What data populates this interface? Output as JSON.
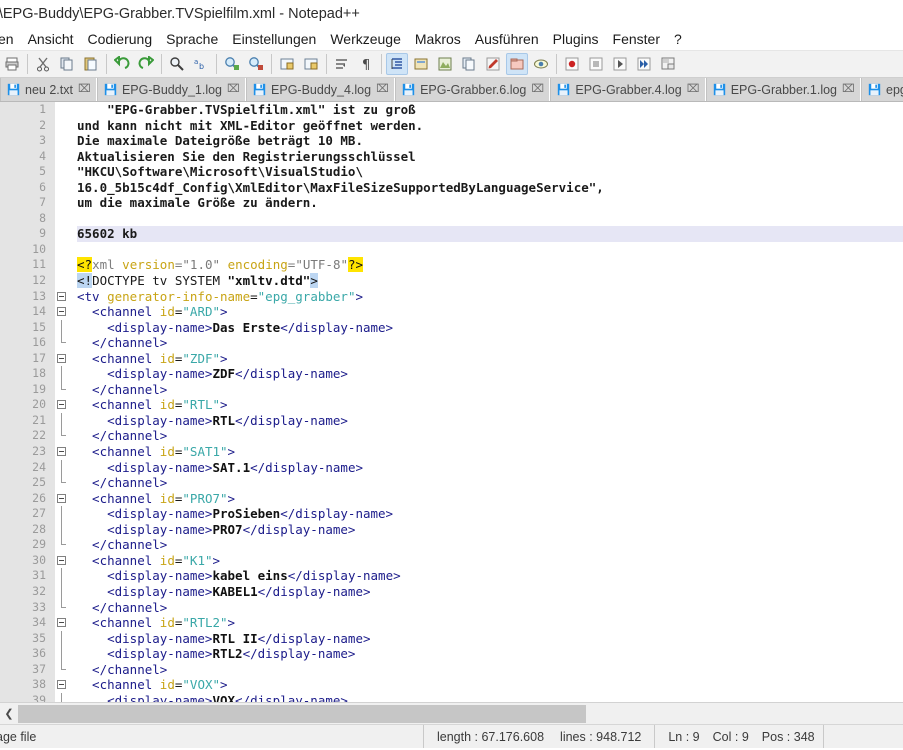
{
  "window": {
    "title": ")\\EPG-Buddy\\EPG-Grabber.TVSpielfilm.xml - Notepad++"
  },
  "menu": {
    "items": [
      {
        "label": "en"
      },
      {
        "label": "Ansicht"
      },
      {
        "label": "Codierung"
      },
      {
        "label": "Sprache"
      },
      {
        "label": "Einstellungen"
      },
      {
        "label": "Werkzeuge"
      },
      {
        "label": "Makros"
      },
      {
        "label": "Ausführen"
      },
      {
        "label": "Plugins"
      },
      {
        "label": "Fenster"
      },
      {
        "label": "?"
      }
    ]
  },
  "toolbar": {
    "buttons": [
      {
        "name": "print-icon",
        "active": false
      },
      {
        "name": "cut-icon",
        "active": false
      },
      {
        "name": "copy-icon",
        "active": false
      },
      {
        "name": "paste-icon",
        "active": false
      },
      {
        "name": "undo-icon",
        "active": false
      },
      {
        "name": "redo-icon",
        "active": false
      },
      {
        "name": "find-icon",
        "active": false
      },
      {
        "name": "replace-icon",
        "active": false
      },
      {
        "name": "zoom-in-icon",
        "active": false
      },
      {
        "name": "zoom-out-icon",
        "active": false
      },
      {
        "name": "sync-vertical-scroll-icon",
        "active": false
      },
      {
        "name": "sync-horizontal-scroll-icon",
        "active": false
      },
      {
        "name": "word-wrap-icon",
        "active": false
      },
      {
        "name": "show-all-characters-icon",
        "active": false
      },
      {
        "name": "indent-guide-icon",
        "active": true
      },
      {
        "name": "user-defined-language-icon",
        "active": false
      },
      {
        "name": "document-map-icon",
        "active": false
      },
      {
        "name": "function-list-icon",
        "active": false
      },
      {
        "name": "folder-as-workspace-icon",
        "active": false
      },
      {
        "name": "monitoring-icon",
        "active": true
      },
      {
        "name": "preview-icon",
        "active": false
      },
      {
        "name": "record-macro-icon",
        "active": false
      },
      {
        "name": "stop-macro-icon",
        "active": false
      },
      {
        "name": "play-macro-icon",
        "active": false
      },
      {
        "name": "run-macro-multiple-icon",
        "active": false
      },
      {
        "name": "save-macro-icon",
        "active": false
      }
    ]
  },
  "tabs": [
    {
      "label": "neu 2.txt",
      "active": false
    },
    {
      "label": "EPG-Buddy_1.log",
      "active": false
    },
    {
      "label": "EPG-Buddy_4.log",
      "active": false
    },
    {
      "label": "EPG-Grabber.6.log",
      "active": false
    },
    {
      "label": "EPG-Grabber.4.log",
      "active": false
    },
    {
      "label": "EPG-Grabber.1.log",
      "active": false
    },
    {
      "label": "epg grabber a",
      "active": false
    }
  ],
  "editor": {
    "first_line": 1,
    "current_line": 9,
    "change_marker_lines": [
      1,
      10
    ],
    "lines": [
      {
        "n": 1,
        "tokens": [
          {
            "c": "t-plain",
            "t": "    \"EPG-Grabber.TVSpielfilm.xml\" ist zu groß"
          }
        ]
      },
      {
        "n": 2,
        "tokens": [
          {
            "c": "t-plain",
            "t": "und kann nicht mit XML-Editor geöffnet werden."
          }
        ]
      },
      {
        "n": 3,
        "tokens": [
          {
            "c": "t-plain",
            "t": "Die maximale Dateigröße beträgt 10 MB."
          }
        ]
      },
      {
        "n": 4,
        "tokens": [
          {
            "c": "t-plain",
            "t": "Aktualisieren Sie den Registrierungsschlüssel"
          }
        ]
      },
      {
        "n": 5,
        "tokens": [
          {
            "c": "t-plain",
            "t": "\"HKCU\\Software\\Microsoft\\VisualStudio\\"
          }
        ]
      },
      {
        "n": 6,
        "tokens": [
          {
            "c": "t-plain",
            "t": "16.0_5b15c4df_Config\\XmlEditor\\MaxFileSizeSupportedByLanguageService\","
          }
        ]
      },
      {
        "n": 7,
        "tokens": [
          {
            "c": "t-plain",
            "t": "um die maximale Größe zu ändern."
          }
        ]
      },
      {
        "n": 8,
        "tokens": []
      },
      {
        "n": 9,
        "tokens": [
          {
            "c": "t-plain",
            "t": "65602 kb"
          }
        ]
      },
      {
        "n": 10,
        "tokens": []
      },
      {
        "n": 11,
        "tokens": [
          {
            "c": "t-pimark",
            "t": "<?"
          },
          {
            "c": "t-pi",
            "t": "xml "
          },
          {
            "c": "t-attr",
            "t": "version"
          },
          {
            "c": "t-pi",
            "t": "="
          },
          {
            "c": "t-str",
            "t": "\"1.0\""
          },
          {
            "c": "t-pi",
            "t": " "
          },
          {
            "c": "t-attr",
            "t": "encoding"
          },
          {
            "c": "t-pi",
            "t": "="
          },
          {
            "c": "t-str",
            "t": "\"UTF-8\""
          },
          {
            "c": "t-pimark",
            "t": "?>"
          }
        ]
      },
      {
        "n": 12,
        "tokens": [
          {
            "c": "t-dtmark",
            "t": "<!"
          },
          {
            "c": "t-doctype",
            "t": "DOCTYPE tv SYSTEM "
          },
          {
            "c": "t-content",
            "t": "\"xmltv.dtd\""
          },
          {
            "c": "t-dtmark",
            "t": ">"
          }
        ]
      },
      {
        "n": 13,
        "tokens": [
          {
            "c": "t-tag",
            "t": "<tv "
          },
          {
            "c": "t-attr",
            "t": "generator-info-name"
          },
          {
            "c": "t-eq",
            "t": "="
          },
          {
            "c": "t-val",
            "t": "\"epg_grabber\""
          },
          {
            "c": "t-tag",
            "t": ">"
          }
        ]
      },
      {
        "n": 14,
        "tokens": [
          {
            "c": "t-tag",
            "t": "  <channel "
          },
          {
            "c": "t-attr",
            "t": "id"
          },
          {
            "c": "t-eq",
            "t": "="
          },
          {
            "c": "t-val",
            "t": "\"ARD\""
          },
          {
            "c": "t-tag",
            "t": ">"
          }
        ]
      },
      {
        "n": 15,
        "tokens": [
          {
            "c": "t-tag",
            "t": "    <display-name>"
          },
          {
            "c": "t-content",
            "t": "Das Erste"
          },
          {
            "c": "t-tag",
            "t": "</display-name>"
          }
        ]
      },
      {
        "n": 16,
        "tokens": [
          {
            "c": "t-tag",
            "t": "  </channel>"
          }
        ]
      },
      {
        "n": 17,
        "tokens": [
          {
            "c": "t-tag",
            "t": "  <channel "
          },
          {
            "c": "t-attr",
            "t": "id"
          },
          {
            "c": "t-eq",
            "t": "="
          },
          {
            "c": "t-val",
            "t": "\"ZDF\""
          },
          {
            "c": "t-tag",
            "t": ">"
          }
        ]
      },
      {
        "n": 18,
        "tokens": [
          {
            "c": "t-tag",
            "t": "    <display-name>"
          },
          {
            "c": "t-content",
            "t": "ZDF"
          },
          {
            "c": "t-tag",
            "t": "</display-name>"
          }
        ]
      },
      {
        "n": 19,
        "tokens": [
          {
            "c": "t-tag",
            "t": "  </channel>"
          }
        ]
      },
      {
        "n": 20,
        "tokens": [
          {
            "c": "t-tag",
            "t": "  <channel "
          },
          {
            "c": "t-attr",
            "t": "id"
          },
          {
            "c": "t-eq",
            "t": "="
          },
          {
            "c": "t-val",
            "t": "\"RTL\""
          },
          {
            "c": "t-tag",
            "t": ">"
          }
        ]
      },
      {
        "n": 21,
        "tokens": [
          {
            "c": "t-tag",
            "t": "    <display-name>"
          },
          {
            "c": "t-content",
            "t": "RTL"
          },
          {
            "c": "t-tag",
            "t": "</display-name>"
          }
        ]
      },
      {
        "n": 22,
        "tokens": [
          {
            "c": "t-tag",
            "t": "  </channel>"
          }
        ]
      },
      {
        "n": 23,
        "tokens": [
          {
            "c": "t-tag",
            "t": "  <channel "
          },
          {
            "c": "t-attr",
            "t": "id"
          },
          {
            "c": "t-eq",
            "t": "="
          },
          {
            "c": "t-val",
            "t": "\"SAT1\""
          },
          {
            "c": "t-tag",
            "t": ">"
          }
        ]
      },
      {
        "n": 24,
        "tokens": [
          {
            "c": "t-tag",
            "t": "    <display-name>"
          },
          {
            "c": "t-content",
            "t": "SAT.1"
          },
          {
            "c": "t-tag",
            "t": "</display-name>"
          }
        ]
      },
      {
        "n": 25,
        "tokens": [
          {
            "c": "t-tag",
            "t": "  </channel>"
          }
        ]
      },
      {
        "n": 26,
        "tokens": [
          {
            "c": "t-tag",
            "t": "  <channel "
          },
          {
            "c": "t-attr",
            "t": "id"
          },
          {
            "c": "t-eq",
            "t": "="
          },
          {
            "c": "t-val",
            "t": "\"PRO7\""
          },
          {
            "c": "t-tag",
            "t": ">"
          }
        ]
      },
      {
        "n": 27,
        "tokens": [
          {
            "c": "t-tag",
            "t": "    <display-name>"
          },
          {
            "c": "t-content",
            "t": "ProSieben"
          },
          {
            "c": "t-tag",
            "t": "</display-name>"
          }
        ]
      },
      {
        "n": 28,
        "tokens": [
          {
            "c": "t-tag",
            "t": "    <display-name>"
          },
          {
            "c": "t-content",
            "t": "PRO7"
          },
          {
            "c": "t-tag",
            "t": "</display-name>"
          }
        ]
      },
      {
        "n": 29,
        "tokens": [
          {
            "c": "t-tag",
            "t": "  </channel>"
          }
        ]
      },
      {
        "n": 30,
        "tokens": [
          {
            "c": "t-tag",
            "t": "  <channel "
          },
          {
            "c": "t-attr",
            "t": "id"
          },
          {
            "c": "t-eq",
            "t": "="
          },
          {
            "c": "t-val",
            "t": "\"K1\""
          },
          {
            "c": "t-tag",
            "t": ">"
          }
        ]
      },
      {
        "n": 31,
        "tokens": [
          {
            "c": "t-tag",
            "t": "    <display-name>"
          },
          {
            "c": "t-content",
            "t": "kabel eins"
          },
          {
            "c": "t-tag",
            "t": "</display-name>"
          }
        ]
      },
      {
        "n": 32,
        "tokens": [
          {
            "c": "t-tag",
            "t": "    <display-name>"
          },
          {
            "c": "t-content",
            "t": "KABEL1"
          },
          {
            "c": "t-tag",
            "t": "</display-name>"
          }
        ]
      },
      {
        "n": 33,
        "tokens": [
          {
            "c": "t-tag",
            "t": "  </channel>"
          }
        ]
      },
      {
        "n": 34,
        "tokens": [
          {
            "c": "t-tag",
            "t": "  <channel "
          },
          {
            "c": "t-attr",
            "t": "id"
          },
          {
            "c": "t-eq",
            "t": "="
          },
          {
            "c": "t-val",
            "t": "\"RTL2\""
          },
          {
            "c": "t-tag",
            "t": ">"
          }
        ]
      },
      {
        "n": 35,
        "tokens": [
          {
            "c": "t-tag",
            "t": "    <display-name>"
          },
          {
            "c": "t-content",
            "t": "RTL II"
          },
          {
            "c": "t-tag",
            "t": "</display-name>"
          }
        ]
      },
      {
        "n": 36,
        "tokens": [
          {
            "c": "t-tag",
            "t": "    <display-name>"
          },
          {
            "c": "t-content",
            "t": "RTL2"
          },
          {
            "c": "t-tag",
            "t": "</display-name>"
          }
        ]
      },
      {
        "n": 37,
        "tokens": [
          {
            "c": "t-tag",
            "t": "  </channel>"
          }
        ]
      },
      {
        "n": 38,
        "tokens": [
          {
            "c": "t-tag",
            "t": "  <channel "
          },
          {
            "c": "t-attr",
            "t": "id"
          },
          {
            "c": "t-eq",
            "t": "="
          },
          {
            "c": "t-val",
            "t": "\"VOX\""
          },
          {
            "c": "t-tag",
            "t": ">"
          }
        ]
      },
      {
        "n": 39,
        "tokens": [
          {
            "c": "t-tag",
            "t": "    <display-name>"
          },
          {
            "c": "t-content",
            "t": "VOX"
          },
          {
            "c": "t-tag",
            "t": "</display-name>"
          }
        ]
      }
    ],
    "folds": {
      "open": [
        13,
        14,
        17,
        20,
        23,
        26,
        30,
        34,
        38
      ],
      "mid": [
        15,
        18,
        21,
        24,
        27,
        28,
        31,
        32,
        35,
        36,
        39
      ],
      "end": [
        16,
        19,
        22,
        25,
        29,
        33,
        37
      ]
    }
  },
  "statusbar": {
    "doc_type": "age file",
    "length_label": "length : 67.176.608",
    "lines_label": "lines : 948.712",
    "ln_label": "Ln : 9",
    "col_label": "Col : 9",
    "pos_label": "Pos : 348"
  },
  "colors": {
    "change_marker": "#e8a33d",
    "current_line": "#e6e6f5",
    "pi_highlight": "#ffe400",
    "doctype_highlight": "#bcd6f2",
    "tab_active_bg": "#d6d6d6",
    "toolbar_active": "#cfe4f7"
  }
}
